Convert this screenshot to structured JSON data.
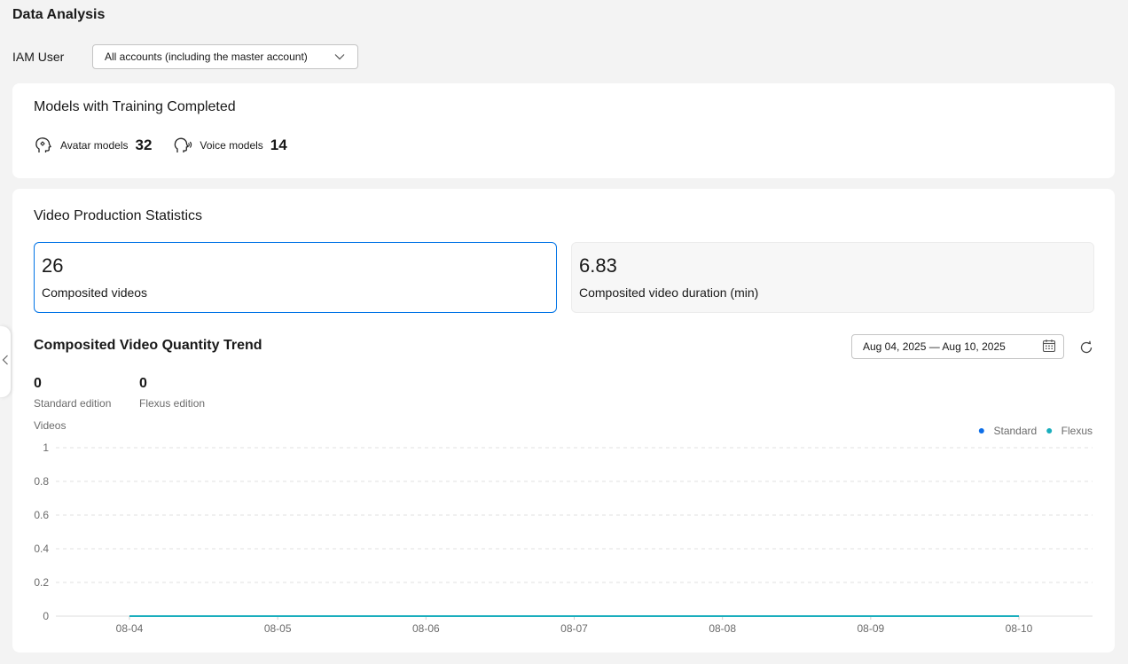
{
  "page": {
    "title": "Data Analysis"
  },
  "iam": {
    "label": "IAM User",
    "selected": "All accounts (including the master account)"
  },
  "models": {
    "title": "Models with Training Completed",
    "avatar_label": "Avatar models",
    "avatar_count": "32",
    "voice_label": "Voice models",
    "voice_count": "14"
  },
  "video_stats": {
    "title": "Video Production Statistics",
    "composited_videos": {
      "value": "26",
      "label": "Composited videos"
    },
    "duration": {
      "value": "6.83",
      "label": "Composited video duration (min)"
    }
  },
  "trend": {
    "title": "Composited Video Quantity Trend",
    "date_range": "Aug 04, 2025 — Aug 10, 2025",
    "standard": {
      "value": "0",
      "label": "Standard edition"
    },
    "flexus": {
      "value": "0",
      "label": "Flexus edition"
    }
  },
  "colors": {
    "accent": "#0073e6",
    "standard": "#0d6ee8",
    "flexus": "#1aaebd"
  },
  "chart_data": {
    "type": "line",
    "ylabel": "Videos",
    "xlabel": "",
    "x": [
      "08-04",
      "08-05",
      "08-06",
      "08-07",
      "08-08",
      "08-09",
      "08-10"
    ],
    "yticks": [
      "0",
      "0.2",
      "0.4",
      "0.6",
      "0.8",
      "1"
    ],
    "ylim": [
      0,
      1
    ],
    "grid": true,
    "legend_position": "top-right",
    "series": [
      {
        "name": "Standard",
        "color": "#0d6ee8",
        "values": [
          0,
          0,
          0,
          0,
          0,
          0,
          0
        ]
      },
      {
        "name": "Flexus",
        "color": "#1aaebd",
        "values": [
          0,
          0,
          0,
          0,
          0,
          0,
          0
        ]
      }
    ]
  }
}
